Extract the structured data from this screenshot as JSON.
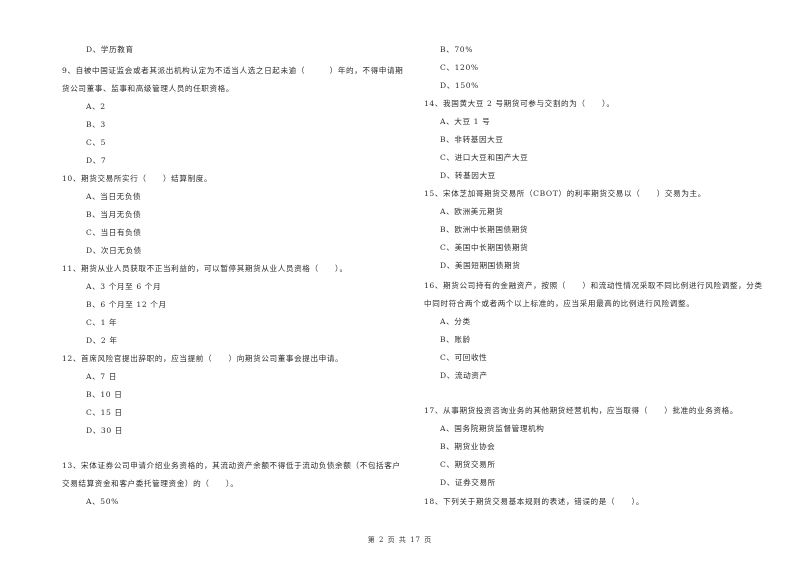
{
  "page": {
    "footer": "第 2 页 共 17 页"
  },
  "left_column": {
    "q8_tail": {
      "option_d": "D、学历教育"
    },
    "q9": {
      "stem_line1": "9、自被中国证监会或者其派出机构认定为不适当人选之日起未逾（　　　）年的，不得申请期",
      "stem_line2": "货公司董事、监事和高级管理人员的任职资格。",
      "options": [
        "A、2",
        "B、3",
        "C、5",
        "D、7"
      ]
    },
    "q10": {
      "stem": "10、期货交易所实行（　　）结算制度。",
      "options": [
        "A、当日无负债",
        "B、当月无负债",
        "C、当日有负债",
        "D、次日无负债"
      ]
    },
    "q11": {
      "stem": "11、期货从业人员获取不正当利益的，可以暂停其期货从业人员资格（　　）。",
      "options": [
        "A、3 个月至 6 个月",
        "B、6 个月至 12 个月",
        "C、1 年",
        "D、2 年"
      ]
    },
    "q12": {
      "stem": "12、首席风险官提出辞职的，应当提前（　　）向期货公司董事会提出申请。",
      "options": [
        "A、7 日",
        "B、10 日",
        "C、15 日",
        "D、30 日"
      ]
    },
    "q13": {
      "stem_line1": "13、宋体证券公司申请介绍业务资格的，其流动资产余额不得低于流动负债余额（不包括客户",
      "stem_line2": "交易结算资金和客户委托管理资金）的（　　）。",
      "options": [
        "A、50%"
      ]
    }
  },
  "right_column": {
    "q13_cont": {
      "options": [
        "B、70%",
        "C、120%",
        "D、150%"
      ]
    },
    "q14": {
      "stem": "14、我国黄大豆 2 号期货可参与交割的为（　　）。",
      "options": [
        "A、大豆 1 号",
        "B、非转基因大豆",
        "C、进口大豆和国产大豆",
        "D、转基因大豆"
      ]
    },
    "q15": {
      "stem": "15、宋体芝加哥期货交易所（CBOT）的利率期货交易以（　　）交易为主。",
      "options": [
        "A、欧洲美元期货",
        "B、欧洲中长期国债期货",
        "C、美国中长期国债期货",
        "D、美国短期国债期货"
      ]
    },
    "q16": {
      "stem_line1": "16、期货公司持有的金融资产，按照（　　）和流动性情况采取不同比例进行风险调整，分类",
      "stem_line2": "中同时符合两个或者两个以上标准的，应当采用最高的比例进行风险调整。",
      "options": [
        "A、分类",
        "B、账龄",
        "C、可回收性",
        "D、流动资产"
      ]
    },
    "q17": {
      "stem": "17、从事期货投资咨询业务的其他期货经营机构，应当取得（　　）批准的业务资格。",
      "options": [
        "A、国务院期货监督管理机构",
        "B、期货业协会",
        "C、期货交易所",
        "D、证券交易所"
      ]
    },
    "q18": {
      "stem": "18、下列关于期货交易基本规则的表述，错误的是（　　）。"
    }
  }
}
